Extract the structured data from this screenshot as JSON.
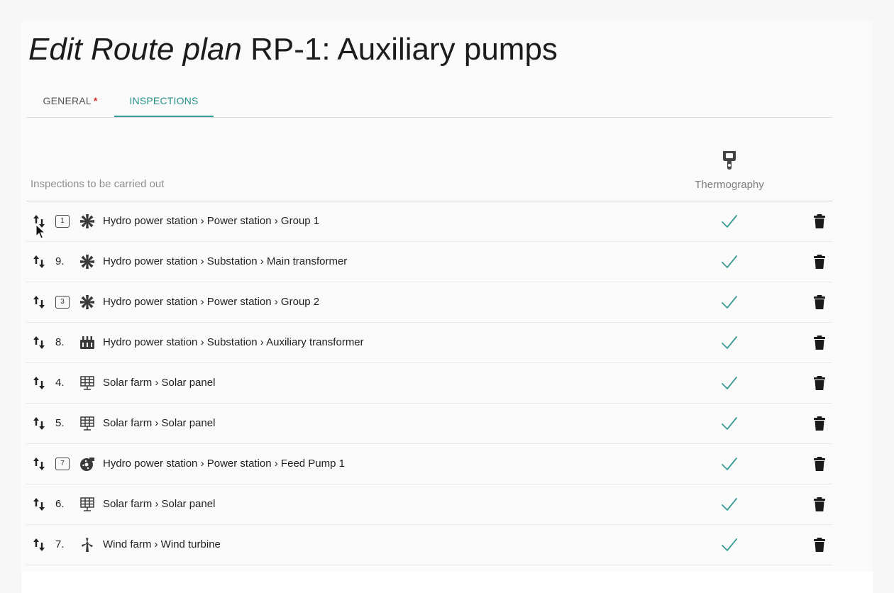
{
  "page": {
    "title_prefix": "Edit Route plan",
    "title_rest": "RP-1: Auxiliary pumps"
  },
  "tabs": [
    {
      "label": "GENERAL",
      "required_mark": "*",
      "active": false
    },
    {
      "label": "INSPECTIONS",
      "active": true
    }
  ],
  "list": {
    "header_label": "Inspections to be carried out",
    "column": {
      "label": "Thermography",
      "icon": "thermography-camera-icon"
    },
    "rows": [
      {
        "order": "1",
        "order_style": "box",
        "icon": "turbine-asterisk-icon",
        "path": "Hydro power station › Power station › Group 1",
        "thermography": true
      },
      {
        "order": "9.",
        "order_style": "plain",
        "icon": "turbine-asterisk-icon",
        "path": "Hydro power station › Substation › Main transformer",
        "thermography": true
      },
      {
        "order": "3",
        "order_style": "box",
        "icon": "turbine-asterisk-icon",
        "path": "Hydro power station › Power station › Group 2",
        "thermography": true
      },
      {
        "order": "8.",
        "order_style": "plain",
        "icon": "transformer-icon",
        "path": "Hydro power station › Substation › Auxiliary transformer",
        "thermography": true
      },
      {
        "order": "4.",
        "order_style": "plain",
        "icon": "solar-panel-icon",
        "path": "Solar farm › Solar panel",
        "thermography": true
      },
      {
        "order": "5.",
        "order_style": "plain",
        "icon": "solar-panel-icon",
        "path": "Solar farm › Solar panel",
        "thermography": true
      },
      {
        "order": "7",
        "order_style": "box",
        "icon": "pump-icon",
        "path": "Hydro power station › Power station › Feed Pump 1",
        "thermography": true
      },
      {
        "order": "6.",
        "order_style": "plain",
        "icon": "solar-panel-icon",
        "path": "Solar farm › Solar panel",
        "thermography": true
      },
      {
        "order": "7.",
        "order_style": "plain",
        "icon": "wind-turbine-icon",
        "path": "Wind farm › Wind turbine",
        "thermography": true
      }
    ]
  },
  "colors": {
    "accent": "#2f9d95",
    "required": "#d32f2f",
    "check": "#3a9b94"
  }
}
